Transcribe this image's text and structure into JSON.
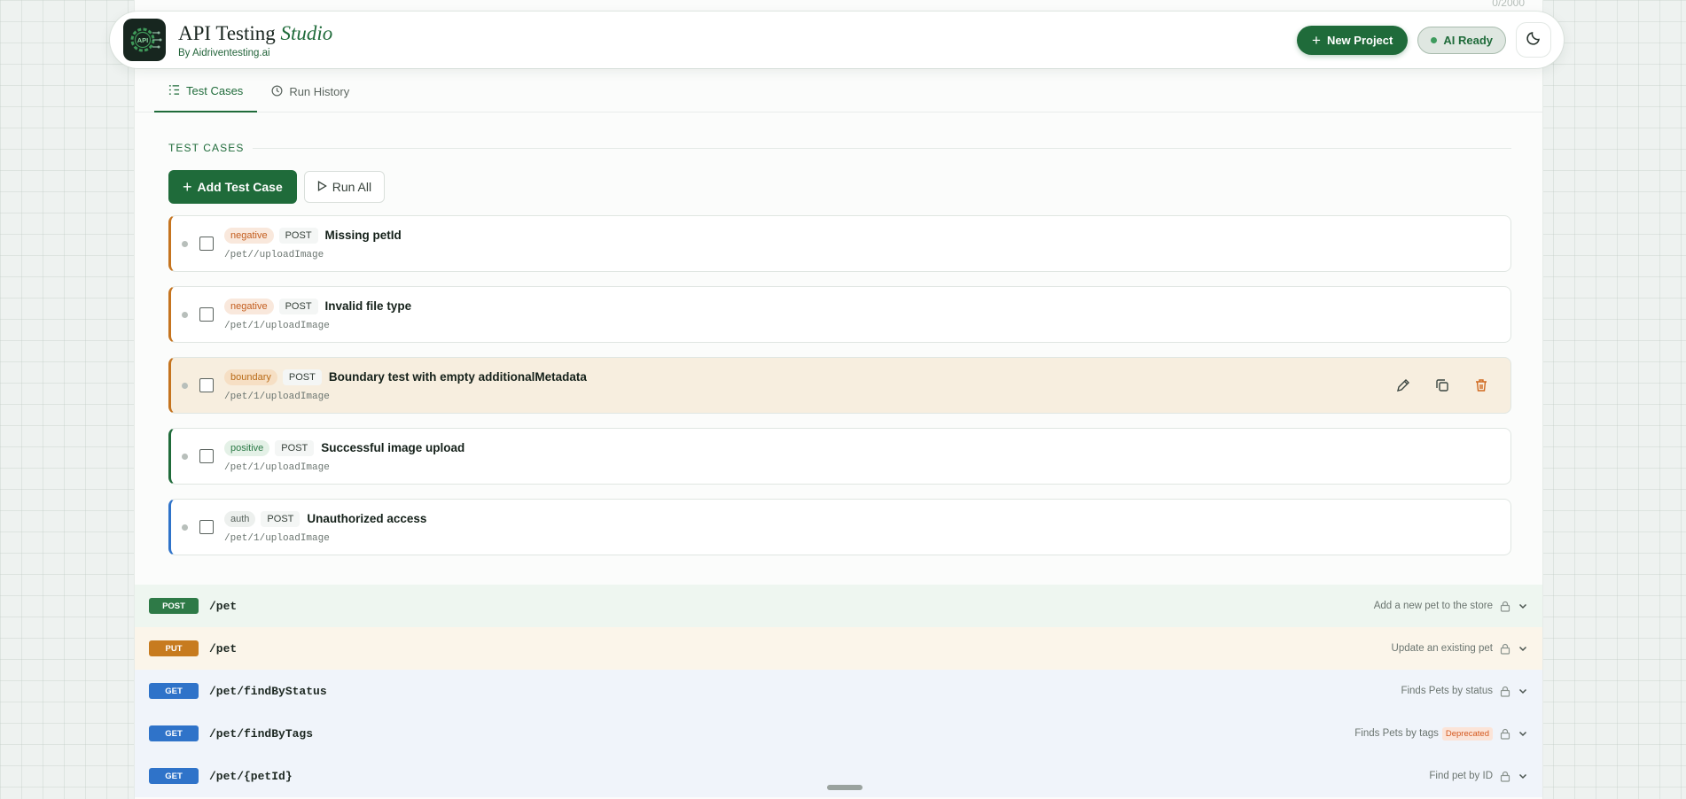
{
  "app": {
    "title": "API Testing",
    "title_accent": "Studio",
    "subtitle": "By Aidriventesting.ai",
    "logo_text": "API",
    "char_count": "0/2000"
  },
  "header": {
    "new_project_label": "New Project",
    "ai_status_label": "AI Ready"
  },
  "tabs": [
    {
      "label": "Test Cases",
      "active": true
    },
    {
      "label": "Run History",
      "active": false
    }
  ],
  "test_cases": {
    "section_title": "TEST CASES",
    "add_label": "Add Test Case",
    "run_all_label": "Run All",
    "items": [
      {
        "tag": "negative",
        "method": "POST",
        "title": "Missing petId",
        "path": "/pet//uploadImage",
        "accent": "#c5741f"
      },
      {
        "tag": "negative",
        "method": "POST",
        "title": "Invalid file type",
        "path": "/pet/1/uploadImage",
        "accent": "#c5741f"
      },
      {
        "tag": "boundary",
        "method": "POST",
        "title": "Boundary test with empty additionalMetadata",
        "path": "/pet/1/uploadImage",
        "accent": "#c5741f"
      },
      {
        "tag": "positive",
        "method": "POST",
        "title": "Successful image upload",
        "path": "/pet/1/uploadImage",
        "accent": "#1f6b3a"
      },
      {
        "tag": "auth",
        "method": "POST",
        "title": "Unauthorized access",
        "path": "/pet/1/uploadImage",
        "accent": "#2f73c9"
      }
    ]
  },
  "endpoints": [
    {
      "method": "POST",
      "path": "/pet",
      "summary": "Add a new pet to the store"
    },
    {
      "method": "PUT",
      "path": "/pet",
      "summary": "Update an existing pet"
    },
    {
      "method": "GET",
      "path": "/pet/findByStatus",
      "summary": "Finds Pets by status"
    },
    {
      "method": "GET",
      "path": "/pet/findByTags",
      "summary": "Finds Pets by tags",
      "badge": "Deprecated"
    },
    {
      "method": "GET",
      "path": "/pet/{petId}",
      "summary": "Find pet by ID"
    }
  ],
  "colors": {
    "brand": "#1f6b3a",
    "post": "#2e7a47",
    "put": "#c77b1f",
    "get": "#2f73c9"
  }
}
